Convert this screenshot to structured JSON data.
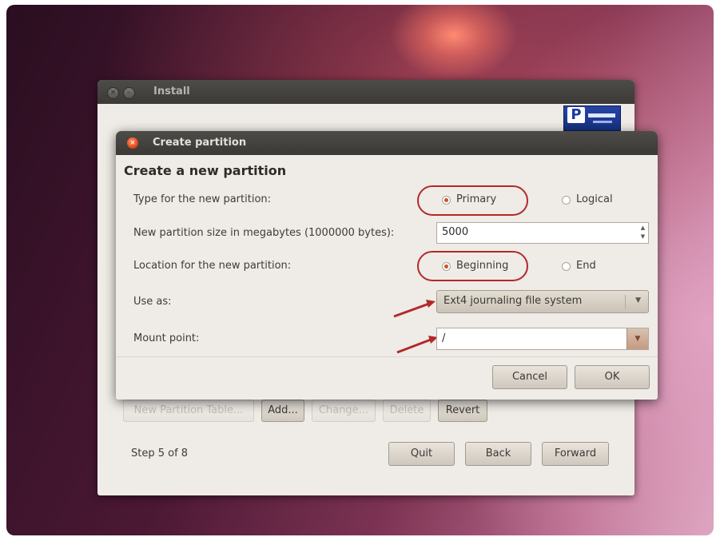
{
  "install_window": {
    "title": "Install",
    "buttons": {
      "new_partition_table": "New Partition Table...",
      "add": "Add...",
      "change": "Change...",
      "delete": "Delete",
      "revert": "Revert"
    },
    "step": "Step 5 of 8",
    "nav": {
      "quit": "Quit",
      "back": "Back",
      "forward": "Forward"
    }
  },
  "dialog": {
    "title": "Create partition",
    "heading": "Create a new partition",
    "type_label": "Type for the new partition:",
    "type_options": {
      "primary": "Primary",
      "logical": "Logical",
      "selected": "primary"
    },
    "size_label": "New partition size in megabytes (1000000 bytes):",
    "size_value": "5000",
    "location_label": "Location for the new partition:",
    "location_options": {
      "beginning": "Beginning",
      "end": "End",
      "selected": "beginning"
    },
    "use_as_label": "Use as:",
    "use_as_value": "Ext4 journaling file system",
    "mount_label": "Mount point:",
    "mount_value": "/",
    "cancel": "Cancel",
    "ok": "OK"
  },
  "colors": {
    "annotation": "#b12a2a",
    "titlebar": "#3c3b37",
    "window_bg": "#efebe6",
    "radio_dot": "#d0502a"
  },
  "icons": [
    "close-icon",
    "minimize-icon",
    "spin-up-icon",
    "spin-down-icon",
    "dropdown-icon",
    "arrow-annotation-icon",
    "logo"
  ]
}
